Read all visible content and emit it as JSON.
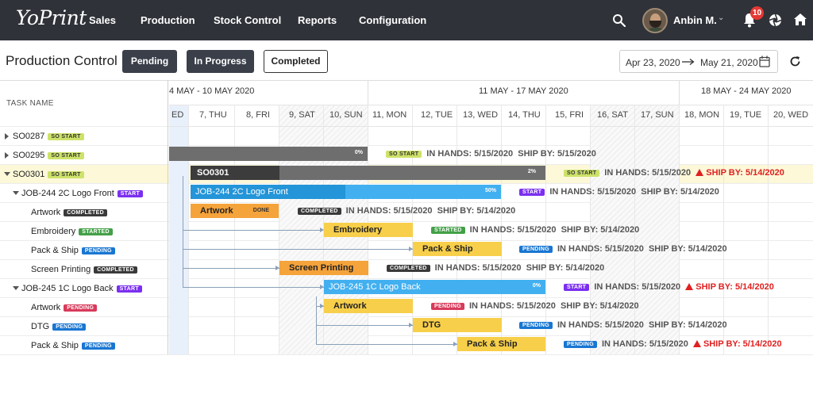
{
  "app": {
    "logo_text": "YoPrint"
  },
  "nav": {
    "items": [
      "Sales",
      "Production",
      "Stock Control",
      "Reports",
      "Configuration"
    ],
    "user_name": "Anbin M.",
    "notification_count": "10",
    "icons": [
      "search-icon",
      "bell-icon",
      "aperture-icon",
      "home-icon"
    ]
  },
  "toolbar": {
    "title": "Production Control",
    "buttons": [
      "Pending",
      "In Progress",
      "Completed"
    ],
    "date_from": "Apr 23, 2020",
    "date_to": "May 21, 2020"
  },
  "gantt": {
    "task_name_header": "TASK NAME",
    "weeks": [
      "4 MAY - 10 MAY 2020",
      "11 MAY - 17 MAY 2020",
      "18 MAY - 24 MAY 2020"
    ],
    "days": [
      "ED",
      "7, THU",
      "8, FRI",
      "9, SAT",
      "10, SUN",
      "11, MON",
      "12, TUE",
      "13, WED",
      "14, THU",
      "15, FRI",
      "16, SAT",
      "17, SUN",
      "18, MON",
      "19, TUE",
      "20, WED"
    ],
    "tasks": [
      {
        "label": "SO0287",
        "status": "SO START"
      },
      {
        "label": "SO0295",
        "status": "SO START"
      },
      {
        "label": "SO0301",
        "status": "SO START"
      },
      {
        "label": "JOB-244 2C Logo Front",
        "status": "START"
      },
      {
        "label": "Artwork",
        "status": "COMPLETED"
      },
      {
        "label": "Embroidery",
        "status": "STARTED"
      },
      {
        "label": "Pack & Ship",
        "status": "PENDING"
      },
      {
        "label": "Screen Printing",
        "status": "COMPLETED"
      },
      {
        "label": "JOB-245 1C Logo Back",
        "status": "START"
      },
      {
        "label": "Artwork",
        "status": "PENDING"
      },
      {
        "label": "DTG",
        "status": "PENDING"
      },
      {
        "label": "Pack & Ship",
        "status": "PENDING"
      }
    ],
    "bars": {
      "so0295_pct": "0%",
      "so0301_label": "SO0301",
      "so0301_pct": "2%",
      "job244_label": "JOB-244 2C Logo Front",
      "job244_pct": "50%",
      "artwork_label": "Artwork",
      "artwork_done": "DONE",
      "embroidery_label": "Embroidery",
      "packship1_label": "Pack & Ship",
      "screen_label": "Screen Printing",
      "job245_label": "JOB-245 1C Logo Back",
      "job245_pct": "0%",
      "artwork2_label": "Artwork",
      "dtg_label": "DTG",
      "packship2_label": "Pack & Ship"
    },
    "info": {
      "in_hands": "IN HANDS: 5/15/2020",
      "ship_by": "SHIP BY: 5/14/2020",
      "ship_by_so0295": "SHIP BY: 5/15/2020"
    }
  },
  "colors": {
    "nav_bg": "#2f3238",
    "bar_grey": "#6e6e6e",
    "bar_blue": "#42b0f0",
    "bar_orange": "#f5a33b",
    "bar_yellow": "#f8cf4a",
    "ship_red": "#e02020"
  }
}
